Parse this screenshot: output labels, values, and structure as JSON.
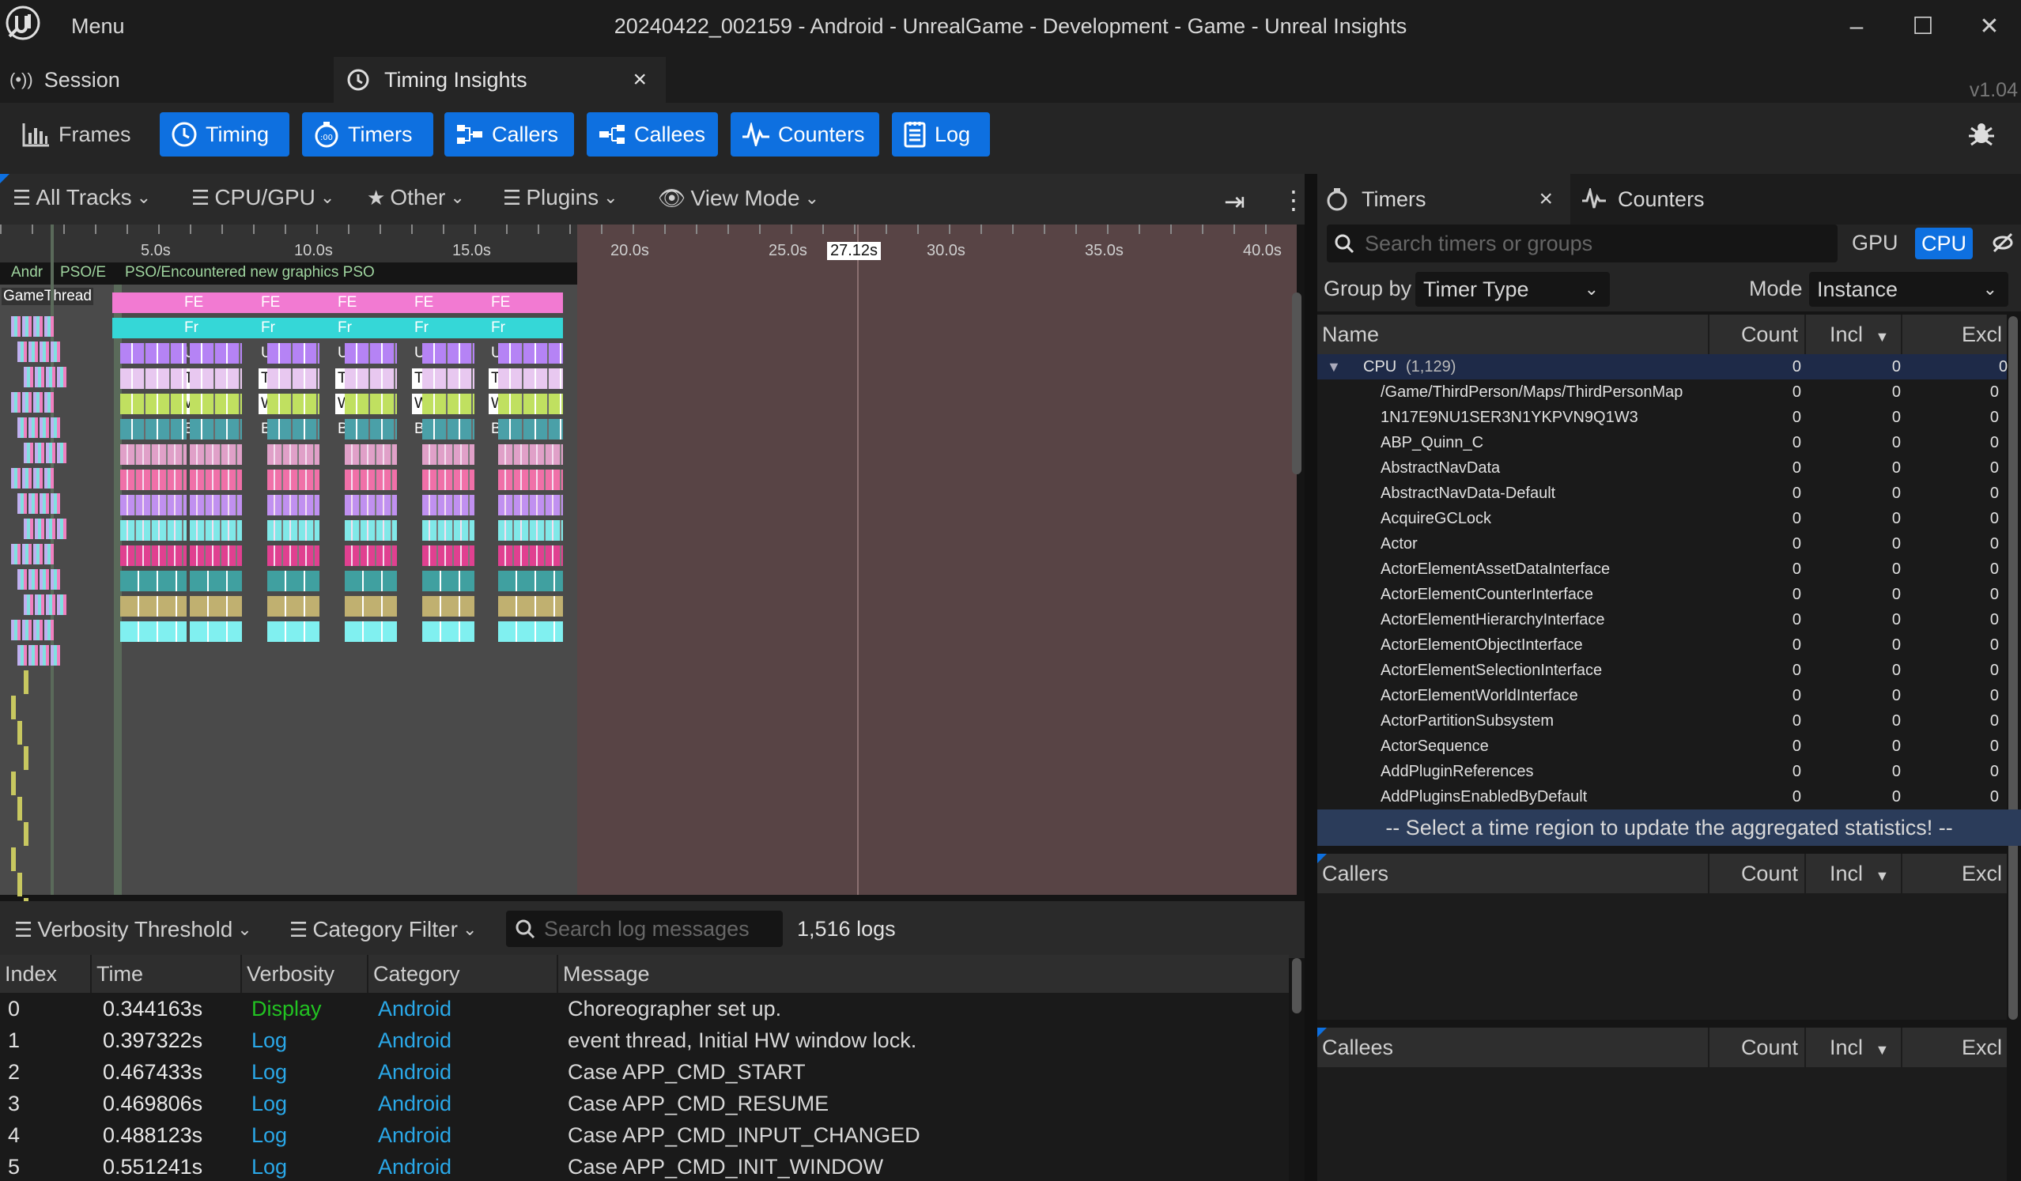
{
  "window": {
    "menu_label": "Menu",
    "title": "20240422_002159 - Android - UnrealGame - Development - Game - Unreal Insights",
    "minimize": "–",
    "maximize": "☐",
    "close": "✕"
  },
  "doc_tabs": {
    "session_label": "Session",
    "timing_label": "Timing Insights",
    "timing_close": "×",
    "version": "v1.04"
  },
  "toolbar": {
    "frames_label": "Frames",
    "timing_label": "Timing",
    "timers_label": "Timers",
    "callers_label": "Callers",
    "callees_label": "Callees",
    "counters_label": "Counters",
    "log_label": "Log",
    "accent": "#0e70e0"
  },
  "timing_filters": {
    "all_tracks": "All Tracks",
    "cpu_gpu": "CPU/GPU",
    "other": "Other",
    "plugins": "Plugins",
    "view_mode": "View Mode"
  },
  "ruler": {
    "ticks": [
      "5.0s",
      "10.0s",
      "15.0s",
      "20.0s",
      "25.0s",
      "27.12s",
      "30.0s",
      "35.0s",
      "40.0s"
    ],
    "marker": "27.12s"
  },
  "tracks": {
    "region_labels": [
      "Andr",
      "PSO/E",
      "PSO/Encountered new graphics PSO"
    ],
    "game_thread": "GameThread",
    "frame_labels": [
      "FE",
      "Fr",
      "U",
      "Tic",
      "Wa",
      "BP"
    ],
    "group_labels": [
      [
        "FE",
        "Fr",
        "U",
        "Tic",
        "Wa",
        "BP"
      ],
      [
        "FE",
        "Fr",
        "U",
        "Tic",
        "Wa",
        "BP"
      ],
      [
        "FE",
        "Fr",
        "U",
        "Tic",
        "Wa",
        "BP"
      ],
      [
        "FE",
        "Fr",
        "U",
        "Tic",
        "Wa",
        "BP"
      ],
      [
        "FE",
        "Fr",
        "U",
        "Ti",
        "W",
        "BP"
      ]
    ]
  },
  "log": {
    "verbosity_threshold": "Verbosity Threshold",
    "category_filter": "Category Filter",
    "search_placeholder": "Search log messages",
    "count": "1,516 logs",
    "columns": [
      "Index",
      "Time",
      "Verbosity",
      "Category",
      "Message"
    ],
    "rows": [
      {
        "index": "0",
        "time": "0.344163s",
        "verbosity": "Display",
        "category": "Android",
        "message": "Choreographer set up."
      },
      {
        "index": "1",
        "time": "0.397322s",
        "verbosity": "Log",
        "category": "Android",
        "message": "event thread, Initial HW window lock."
      },
      {
        "index": "2",
        "time": "0.467433s",
        "verbosity": "Log",
        "category": "Android",
        "message": "Case APP_CMD_START"
      },
      {
        "index": "3",
        "time": "0.469806s",
        "verbosity": "Log",
        "category": "Android",
        "message": "Case APP_CMD_RESUME"
      },
      {
        "index": "4",
        "time": "0.488123s",
        "verbosity": "Log",
        "category": "Android",
        "message": "Case APP_CMD_INPUT_CHANGED"
      },
      {
        "index": "5",
        "time": "0.551241s",
        "verbosity": "Log",
        "category": "Android",
        "message": "Case APP_CMD_INIT_WINDOW"
      }
    ],
    "colors": {
      "display": "#22c322",
      "log": "#2aa8e8",
      "category": "#2aa8e8"
    }
  },
  "timers_panel": {
    "tab_timers": "Timers",
    "tab_close": "×",
    "tab_counters": "Counters",
    "search_placeholder": "Search timers or groups",
    "gpu_label": "GPU",
    "cpu_label": "CPU",
    "group_by_label": "Group by",
    "group_by_value": "Timer Type",
    "mode_label": "Mode",
    "mode_value": "Instance",
    "columns": {
      "name": "Name",
      "count": "Count",
      "incl": "Incl",
      "excl": "Excl"
    },
    "root": {
      "name": "CPU",
      "count_text": "(1,129)",
      "count": "0",
      "incl": "0",
      "excl": "0"
    },
    "rows": [
      {
        "name": "/Game/ThirdPerson/Maps/ThirdPersonMap",
        "count": "0",
        "incl": "0",
        "excl": "0"
      },
      {
        "name": "1N17E9NU1SER3N1YKPVN9Q1W3",
        "count": "0",
        "incl": "0",
        "excl": "0"
      },
      {
        "name": "ABP_Quinn_C",
        "count": "0",
        "incl": "0",
        "excl": "0"
      },
      {
        "name": "AbstractNavData",
        "count": "0",
        "incl": "0",
        "excl": "0"
      },
      {
        "name": "AbstractNavData-Default",
        "count": "0",
        "incl": "0",
        "excl": "0"
      },
      {
        "name": "AcquireGCLock",
        "count": "0",
        "incl": "0",
        "excl": "0"
      },
      {
        "name": "Actor",
        "count": "0",
        "incl": "0",
        "excl": "0"
      },
      {
        "name": "ActorElementAssetDataInterface",
        "count": "0",
        "incl": "0",
        "excl": "0"
      },
      {
        "name": "ActorElementCounterInterface",
        "count": "0",
        "incl": "0",
        "excl": "0"
      },
      {
        "name": "ActorElementHierarchyInterface",
        "count": "0",
        "incl": "0",
        "excl": "0"
      },
      {
        "name": "ActorElementObjectInterface",
        "count": "0",
        "incl": "0",
        "excl": "0"
      },
      {
        "name": "ActorElementSelectionInterface",
        "count": "0",
        "incl": "0",
        "excl": "0"
      },
      {
        "name": "ActorElementWorldInterface",
        "count": "0",
        "incl": "0",
        "excl": "0"
      },
      {
        "name": "ActorPartitionSubsystem",
        "count": "0",
        "incl": "0",
        "excl": "0"
      },
      {
        "name": "ActorSequence",
        "count": "0",
        "incl": "0",
        "excl": "0"
      },
      {
        "name": "AddPluginReferences",
        "count": "0",
        "incl": "0",
        "excl": "0"
      },
      {
        "name": "AddPluginsEnabledByDefault",
        "count": "0",
        "incl": "0",
        "excl": "0"
      }
    ],
    "select_message": "-- Select a time region to update the aggregated statistics! --"
  },
  "callers_panel": {
    "title": "Callers",
    "count": "Count",
    "incl": "Incl",
    "excl": "Excl"
  },
  "callees_panel": {
    "title": "Callees",
    "count": "Count",
    "incl": "Incl",
    "excl": "Excl"
  }
}
